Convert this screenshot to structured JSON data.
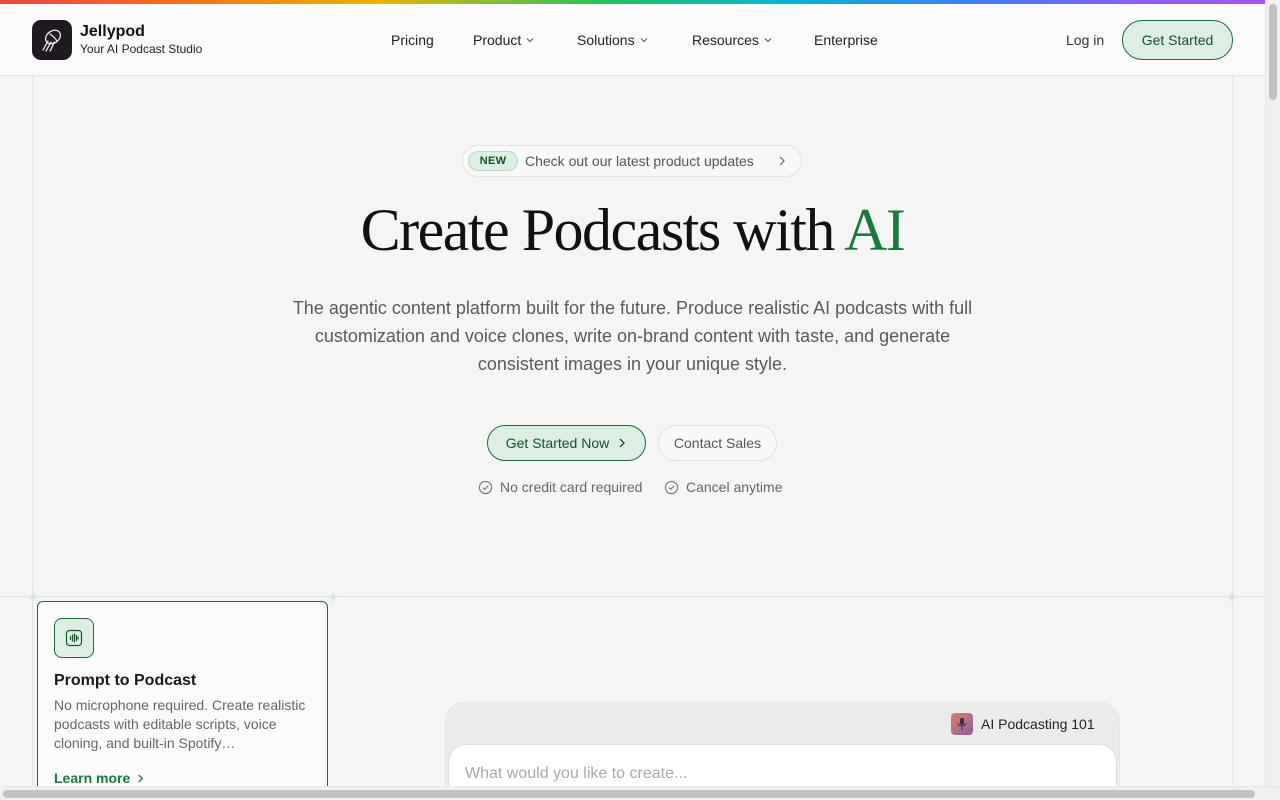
{
  "header": {
    "brand_name": "Jellypod",
    "brand_tagline": "Your AI Podcast Studio",
    "nav": [
      {
        "label": "Pricing"
      },
      {
        "label": "Product"
      },
      {
        "label": "Solutions"
      },
      {
        "label": "Resources"
      },
      {
        "label": "Enterprise"
      }
    ],
    "login_label": "Log in",
    "cta_label": "Get Started"
  },
  "hero": {
    "badge": "NEW",
    "announcement": "Check out our latest product updates",
    "title_main": "Create Podcasts with ",
    "title_accent": "AI",
    "subtitle": "The agentic content platform built for the future. Produce realistic AI podcasts with full customization and voice clones, write on-brand content with taste, and generate consistent images in your unique style.",
    "primary_cta": "Get Started Now",
    "secondary_cta": "Contact Sales",
    "checks": [
      "No credit card required",
      "Cancel anytime"
    ]
  },
  "feature": {
    "title": "Prompt to Podcast",
    "description": "No microphone required. Create realistic podcasts with editable scripts, voice cloning, and built-in Spotify…",
    "link": "Learn more"
  },
  "prompt": {
    "tag": "AI Podcasting 101",
    "placeholder": "What would you like to create..."
  },
  "colors": {
    "accent": "#1a7a3c",
    "accent_bg": "#dcefe2",
    "page_bg": "#f5f5f5"
  }
}
